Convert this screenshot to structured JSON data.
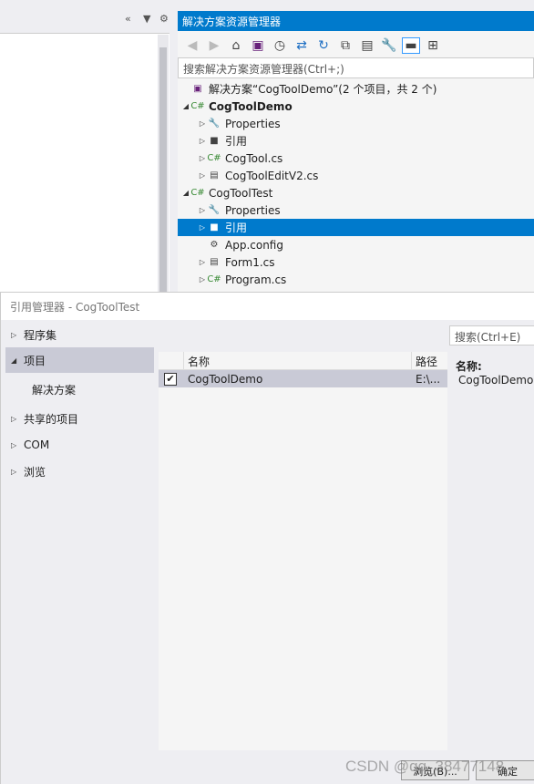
{
  "left_pane": {
    "icons": [
      "collapse-icon",
      "dropdown-icon",
      "gear-icon"
    ]
  },
  "solution_explorer": {
    "title": "解决方案资源管理器",
    "search_placeholder": "搜索解决方案资源管理器(Ctrl+;)",
    "tree": [
      {
        "label": "解决方案“CogToolDemo”(2 个项目，共 2 个)",
        "icon": "solution-icon",
        "arrow": ""
      },
      {
        "label": "CogToolDemo",
        "icon": "csharp-project-icon",
        "arrow": "expanded",
        "bold": true
      },
      {
        "label": "Properties",
        "icon": "wrench-icon",
        "arrow": "collapsed"
      },
      {
        "label": "引用",
        "icon": "references-icon",
        "arrow": "collapsed"
      },
      {
        "label": "CogTool.cs",
        "icon": "csharp-file-icon",
        "arrow": "collapsed"
      },
      {
        "label": "CogToolEditV2.cs",
        "icon": "form-icon",
        "arrow": "collapsed"
      },
      {
        "label": "CogToolTest",
        "icon": "csharp-project-icon",
        "arrow": "expanded"
      },
      {
        "label": "Properties",
        "icon": "wrench-icon",
        "arrow": "collapsed"
      },
      {
        "label": "引用",
        "icon": "references-icon",
        "arrow": "collapsed",
        "selected": true
      },
      {
        "label": "App.config",
        "icon": "config-icon",
        "arrow": ""
      },
      {
        "label": "Form1.cs",
        "icon": "form-icon",
        "arrow": "collapsed"
      },
      {
        "label": "Program.cs",
        "icon": "csharp-file-icon",
        "arrow": "collapsed"
      }
    ]
  },
  "dialog": {
    "title": "引用管理器 - CogToolTest",
    "nav": [
      {
        "label": "程序集",
        "arrow": "collapsed"
      },
      {
        "label": "项目",
        "arrow": "expanded",
        "selected": true
      },
      {
        "label": "解决方案",
        "arrow": ""
      },
      {
        "label": "共享的项目",
        "arrow": "collapsed"
      },
      {
        "label": "COM",
        "arrow": "collapsed"
      },
      {
        "label": "浏览",
        "arrow": "collapsed"
      }
    ],
    "columns": {
      "name": "名称",
      "path": "路径"
    },
    "rows": [
      {
        "checked": true,
        "name": "CogToolDemo",
        "path": "E:\\..."
      }
    ],
    "search_placeholder": "搜索(Ctrl+E)",
    "detail": {
      "label": "名称:",
      "value": "CogToolDemo"
    },
    "buttons": {
      "browse": "浏览(B)...",
      "ok": "确定"
    },
    "watermark": "CSDN @qq_38477148"
  },
  "colors": {
    "accent": "#007acc",
    "selection": "#c9cad6"
  }
}
